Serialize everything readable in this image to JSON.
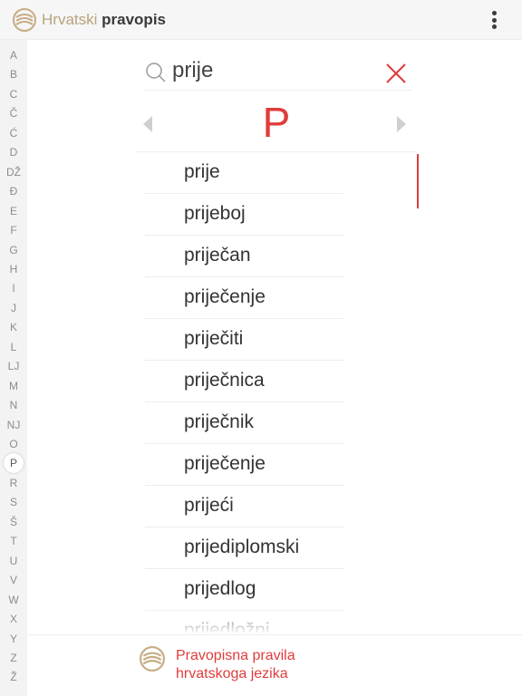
{
  "header": {
    "brand_light": "Hrvatski",
    "brand_bold": "pravopis",
    "logo_icon": "pravopis-logo-icon",
    "menu_icon": "vertical-dots-icon"
  },
  "alphabet": [
    "A",
    "B",
    "C",
    "Č",
    "Ć",
    "D",
    "DŽ",
    "Đ",
    "E",
    "F",
    "G",
    "H",
    "I",
    "J",
    "K",
    "L",
    "LJ",
    "M",
    "N",
    "NJ",
    "O",
    "P",
    "R",
    "S",
    "Š",
    "T",
    "U",
    "V",
    "W",
    "X",
    "Y",
    "Z",
    "Ž"
  ],
  "active_letter": "P",
  "search": {
    "value": "prije",
    "icon": "search-icon",
    "clear_icon": "close-icon"
  },
  "letter_nav": {
    "current": "P",
    "prev_icon": "triangle-left-icon",
    "next_icon": "triangle-right-icon"
  },
  "results": [
    "prije",
    "prijeboj",
    "priječan",
    "priječenje",
    "priječiti",
    "priječnica",
    "priječnik",
    "priječenje",
    "prijeći",
    "prijediplomski",
    "prijedlog",
    "prijedložni"
  ],
  "footer": {
    "line1": "Pravopisna pravila",
    "line2": "hrvatskoga jezika",
    "logo_icon": "pravopis-logo-icon"
  },
  "colors": {
    "accent": "#e03c3c",
    "brand_gold": "#b9a47d"
  }
}
